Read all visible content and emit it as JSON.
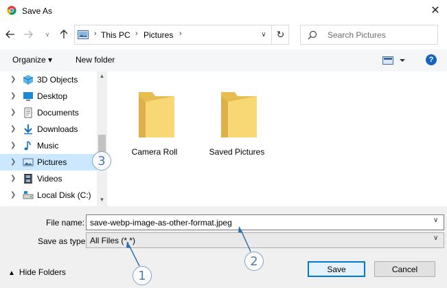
{
  "window": {
    "title": "Save As"
  },
  "address": {
    "crumbs": [
      "This PC",
      "Pictures"
    ],
    "separator": "›"
  },
  "search": {
    "placeholder": "Search Pictures"
  },
  "toolbar": {
    "organize_label": "Organize ▾",
    "new_folder_label": "New folder",
    "help_label": "?"
  },
  "sidebar": {
    "items": [
      {
        "label": "3D Objects",
        "icon": "cube-icon"
      },
      {
        "label": "Desktop",
        "icon": "desktop-icon"
      },
      {
        "label": "Documents",
        "icon": "documents-icon"
      },
      {
        "label": "Downloads",
        "icon": "download-arrow-icon"
      },
      {
        "label": "Music",
        "icon": "music-note-icon"
      },
      {
        "label": "Pictures",
        "icon": "pictures-icon",
        "selected": true
      },
      {
        "label": "Videos",
        "icon": "film-icon"
      },
      {
        "label": "Local Disk (C:)",
        "icon": "drive-icon"
      }
    ]
  },
  "content": {
    "folders": [
      {
        "label": "Camera Roll"
      },
      {
        "label": "Saved Pictures"
      }
    ]
  },
  "form": {
    "filename_label": "File name:",
    "filename_value": "save-webp-image-as-other-format.jpeg",
    "savetype_label": "Save as type:",
    "savetype_value": "All Files (*.*)"
  },
  "footer": {
    "hide_folders_label": "Hide Folders",
    "save_label": "Save",
    "cancel_label": "Cancel"
  },
  "annotations": {
    "callouts": [
      "1",
      "2",
      "3"
    ]
  },
  "colors": {
    "accent": "#0078d7",
    "selected": "#cce8ff",
    "folder": "#f8d775",
    "callout": "#4d7cab"
  }
}
